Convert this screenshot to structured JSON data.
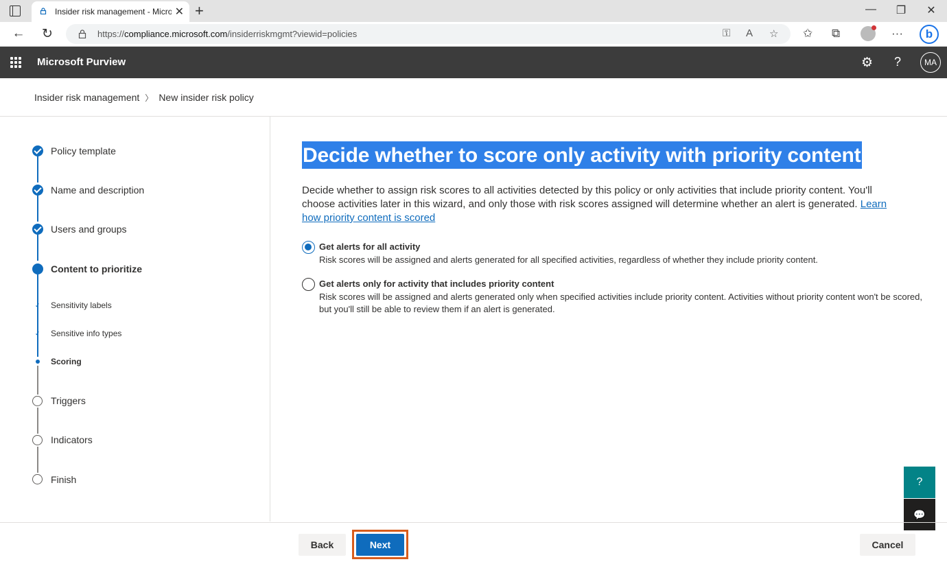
{
  "browser": {
    "tab_title": "Insider risk management - Micro",
    "url_prefix": "https://",
    "url_host": "compliance.microsoft.com",
    "url_path": "/insiderriskmgmt?viewid=policies"
  },
  "app": {
    "name": "Microsoft Purview",
    "avatar_initials": "MA"
  },
  "breadcrumb": {
    "items": [
      "Insider risk management",
      "New insider risk policy"
    ]
  },
  "stepper": {
    "steps": [
      {
        "label": "Policy template",
        "state": "completed"
      },
      {
        "label": "Name and description",
        "state": "completed"
      },
      {
        "label": "Users and groups",
        "state": "completed"
      },
      {
        "label": "Content to prioritize",
        "state": "current"
      },
      {
        "label": "Sensitivity labels",
        "state": "sub-completed"
      },
      {
        "label": "Sensitive info types",
        "state": "sub-completed"
      },
      {
        "label": "Scoring",
        "state": "sub-current"
      },
      {
        "label": "Triggers",
        "state": "not-started"
      },
      {
        "label": "Indicators",
        "state": "not-started"
      },
      {
        "label": "Finish",
        "state": "not-started"
      }
    ]
  },
  "main": {
    "title": "Decide whether to score only activity with priority content",
    "description": "Decide whether to assign risk scores to all activities detected by this policy or only activities that include priority content. You'll choose activities later in this wizard, and only those with risk scores assigned will determine whether an alert is generated.",
    "learn_link": "Learn how priority content is scored",
    "options": [
      {
        "label": "Get alerts for all activity",
        "description": "Risk scores will be assigned and alerts generated for all specified activities, regardless of whether they include priority content.",
        "selected": true
      },
      {
        "label": "Get alerts only for activity that includes priority content",
        "description": "Risk scores will be assigned and alerts generated only when specified activities include priority content. Activities without priority content won't be scored, but you'll still be able to review them if an alert is generated.",
        "selected": false
      }
    ]
  },
  "footer": {
    "back_label": "Back",
    "next_label": "Next",
    "cancel_label": "Cancel"
  },
  "colors": {
    "accent": "#0f6cbd",
    "header_bg": "#3c3c3c",
    "title_highlight": "#2f80e8",
    "next_focus_ring": "#d85c1b"
  }
}
